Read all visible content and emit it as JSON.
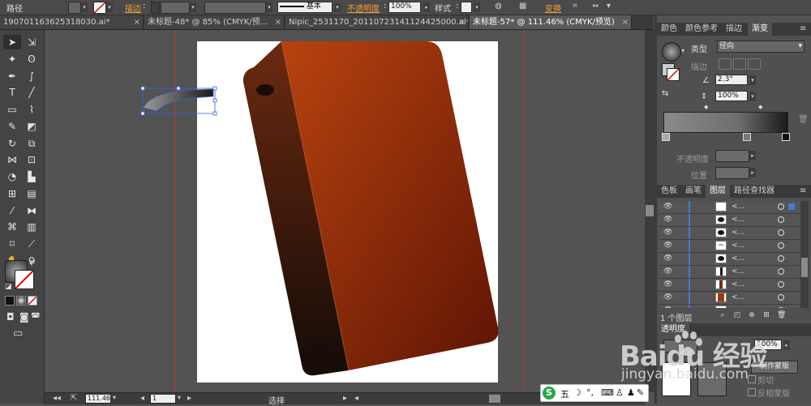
{
  "control_bar": {
    "object_type": "路径",
    "stroke_label": "描边",
    "stroke_style": "基本",
    "opacity_label": "不透明度",
    "opacity_value": "100%",
    "style_label": "样式",
    "transform_label": "变换"
  },
  "tabs": [
    {
      "label": "190701163625318030.ai*",
      "active": false
    },
    {
      "label": "未标题-48* @ 85% (CMYK/预...",
      "active": false
    },
    {
      "label": "Nipic_2531170_20110723141124425000.ai*",
      "active": false
    },
    {
      "label": "未标题-57* @ 111.46% (CMYK/预览)",
      "active": true
    }
  ],
  "gradient_panel": {
    "tabs": [
      "颜色",
      "颜色参考",
      "描边",
      "渐变"
    ],
    "active_tab": "渐变",
    "type_label": "类型",
    "type_value": "径向",
    "stroke_label": "描边",
    "angle_value": "2.3°",
    "aspect_value": "100%",
    "opacity_label": "不透明度",
    "location_label": "位置"
  },
  "layers_panel": {
    "tabs": [
      "色板",
      "画笔",
      "图层",
      "路径查找器"
    ],
    "active_tab": "图层",
    "rows": [
      {
        "name": "<...",
        "thumb": "white"
      },
      {
        "name": "<...",
        "thumb": "black-oval"
      },
      {
        "name": "<...",
        "thumb": "black-oval"
      },
      {
        "name": "<...",
        "thumb": "arc"
      },
      {
        "name": "<...",
        "thumb": "black-oval"
      },
      {
        "name": "<...",
        "thumb": "dark-strip"
      },
      {
        "name": "<...",
        "thumb": "brown-strip"
      },
      {
        "name": "<...",
        "thumb": "brown"
      },
      {
        "name": "<...",
        "thumb": "white"
      }
    ],
    "footer_count": "1 个图层"
  },
  "transparency_panel": {
    "tab": "透明度",
    "value": "100%",
    "make_mask_button": "制作蒙版",
    "clip_label": "剪切",
    "invert_mask_label": "反相蒙版"
  },
  "status_bar": {
    "zoom": "111.46",
    "page": "1",
    "tool_status": "选择"
  },
  "ime": {
    "mode": "五"
  },
  "watermark": {
    "brand": "Baidu 经验",
    "url": "jingyan.baidu.com"
  },
  "colors": {
    "book_cover_light": "#b8430f",
    "book_cover_dark": "#5e1405",
    "book_spine_light": "#6b2a10",
    "book_spine_dark": "#140b08",
    "gradient_start": "#8a8a8a",
    "gradient_end": "#1a1a1a",
    "selection_blue": "#3b63d6"
  }
}
